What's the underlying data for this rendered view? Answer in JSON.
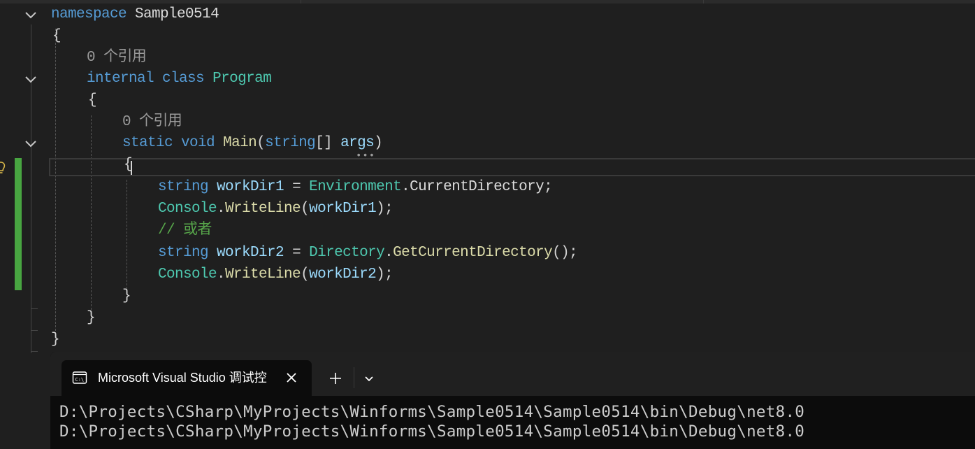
{
  "editor": {
    "code_lens_ns_class": "0 个引用",
    "code_lens_main": "0 个引用",
    "line_namespace": {
      "kw": "namespace",
      "name": "Sample0514"
    },
    "brace_open_ns": "{",
    "line_class": {
      "kw1": "internal",
      "kw2": "class",
      "name": "Program"
    },
    "brace_open_class": "{",
    "line_main": {
      "kw1": "static",
      "kw2": "void",
      "name": "Main",
      "open": "(",
      "ptype": "string",
      "arr": "[]",
      "pname": "args",
      "close": ")"
    },
    "brace_open_main": "{",
    "line1": {
      "t": "string",
      "v": "workDir1",
      "eq": " = ",
      "cls": "Environment",
      "dot": ".",
      "prop": "CurrentDirectory",
      "end": ";"
    },
    "line2": {
      "cls": "Console",
      "dot": ".",
      "m": "WriteLine",
      "open": "(",
      "arg": "workDir1",
      "close": ");"
    },
    "comment": "// 或者",
    "line3": {
      "t": "string",
      "v": "workDir2",
      "eq": " = ",
      "cls": "Directory",
      "dot": ".",
      "m": "GetCurrentDirectory",
      "tail": "();"
    },
    "line4": {
      "cls": "Console",
      "dot": ".",
      "m": "WriteLine",
      "open": "(",
      "arg": "workDir2",
      "close": ");"
    },
    "brace_close_main": "}",
    "brace_close_class": "}",
    "brace_close_ns": "}"
  },
  "terminal": {
    "tab_title": "Microsoft Visual Studio 调试控",
    "output": [
      "D:\\Projects\\CSharp\\MyProjects\\Winforms\\Sample0514\\Sample0514\\bin\\Debug\\net8.0",
      "D:\\Projects\\CSharp\\MyProjects\\Winforms\\Sample0514\\Sample0514\\bin\\Debug\\net8.0"
    ]
  },
  "icons": {
    "fold": "chevron-down-icon",
    "bulb": "lightbulb-icon",
    "terminal": "terminal-icon",
    "close": "close-icon",
    "add": "plus-icon",
    "dropdown": "chevron-down-icon"
  },
  "colors": {
    "keyword": "#569cd6",
    "type": "#4ec9b0",
    "method": "#dcdcaa",
    "variable": "#9cdcfe",
    "comment": "#57a64a",
    "change_bar": "#48a541",
    "editor_bg": "#1f1f1f",
    "terminal_bg": "#0c0c0c"
  }
}
